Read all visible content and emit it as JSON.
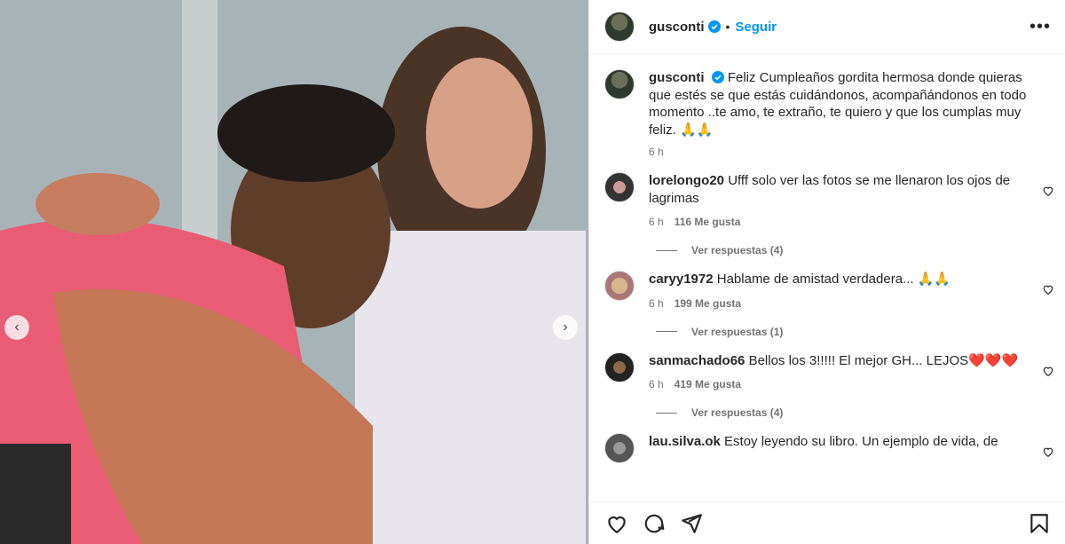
{
  "post": {
    "username": "gusconti",
    "follow_label": "Seguir",
    "dot": "•",
    "more": "•••",
    "caption": "Feliz Cumpleaños gordita hermosa donde quieras que estés se que estás cuidándonos, acompañándonos en todo momento ..te amo, te extraño, te quiero y que los cumplas muy feliz. 🙏🙏",
    "caption_time": "6 h"
  },
  "comments": [
    {
      "username": "lorelongo20",
      "text": "Ufff solo ver las fotos se me llenaron los ojos de lagrimas",
      "time": "6 h",
      "likes": "116 Me gusta",
      "replies": "Ver respuestas (4)"
    },
    {
      "username": "caryy1972",
      "text": "Hablame de amistad verdadera... 🙏🙏",
      "time": "6 h",
      "likes": "199 Me gusta",
      "replies": "Ver respuestas (1)"
    },
    {
      "username": "sanmachado66",
      "text": "Bellos los 3!!!!! El mejor GH... LEJOS❤️❤️❤️",
      "time": "6 h",
      "likes": "419 Me gusta",
      "replies": "Ver respuestas (4)"
    },
    {
      "username": "lau.silva.ok",
      "text": "Estoy leyendo su libro. Un ejemplo de vida, de",
      "time": "",
      "likes": "",
      "replies": ""
    }
  ],
  "icons": {
    "prev": "‹",
    "next": "›"
  },
  "colors": {
    "accent": "#0095f6",
    "muted": "#737373"
  }
}
